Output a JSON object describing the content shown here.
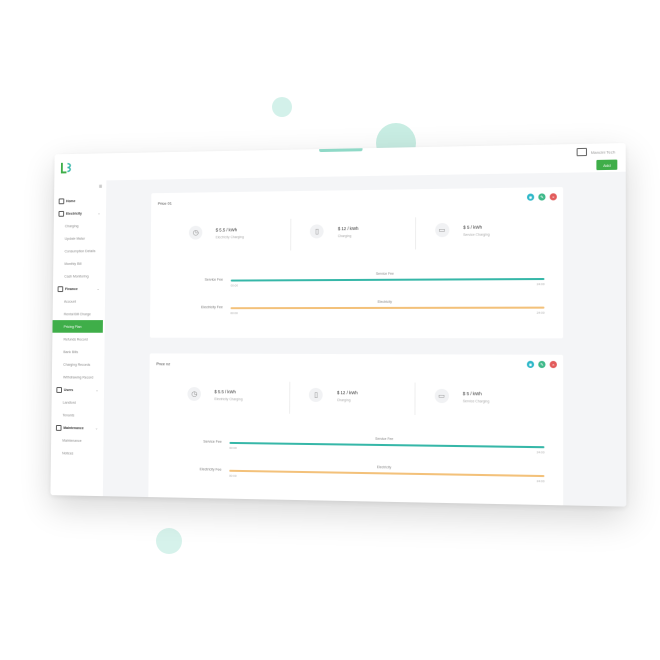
{
  "app": {
    "user_label": "Mancini Tech",
    "add_label": "Add",
    "colors": {
      "accent": "#3fae49",
      "teal": "#36b7a8",
      "orange": "#f3c17a"
    }
  },
  "sidebar": {
    "items": [
      {
        "label": "Home",
        "type": "section",
        "icon": "home-icon"
      },
      {
        "label": "Electricity",
        "type": "section",
        "icon": "electricity-icon",
        "expandable": true
      },
      {
        "label": "Charging",
        "type": "item"
      },
      {
        "label": "Update Meter",
        "type": "item"
      },
      {
        "label": "Consumption Details",
        "type": "item"
      },
      {
        "label": "Monthly Bill",
        "type": "item"
      },
      {
        "label": "Cash Monitoring",
        "type": "item"
      },
      {
        "label": "Finance",
        "type": "section",
        "icon": "finance-icon",
        "expandable": true
      },
      {
        "label": "Account",
        "type": "item"
      },
      {
        "label": "Rental Bill Charge",
        "type": "item"
      },
      {
        "label": "Pricing Plan",
        "type": "item",
        "active": true
      },
      {
        "label": "Refunds Record",
        "type": "item"
      },
      {
        "label": "Bank Bills",
        "type": "item"
      },
      {
        "label": "Charging Records",
        "type": "item"
      },
      {
        "label": "Withdrawing Record",
        "type": "item"
      },
      {
        "label": "Users",
        "type": "section",
        "icon": "users-icon",
        "expandable": true
      },
      {
        "label": "Landlord",
        "type": "item"
      },
      {
        "label": "Tenants",
        "type": "item"
      },
      {
        "label": "Maintenance",
        "type": "section",
        "icon": "maintenance-icon",
        "expandable": true
      },
      {
        "label": "Maintenance",
        "type": "item"
      },
      {
        "label": "Notices",
        "type": "item"
      }
    ]
  },
  "panels": [
    {
      "title": "Price 01",
      "stats": [
        {
          "icon": "clock-icon",
          "value": "$ 5.5 / kWh",
          "label": "Electricity Charging"
        },
        {
          "icon": "battery-icon",
          "value": "$ 12 / kWh",
          "label": "Charging"
        },
        {
          "icon": "phone-icon",
          "value": "$ 5 / kWh",
          "label": "Service Charging"
        }
      ],
      "tracks": [
        {
          "label": "Service Fee",
          "mid": "Service Fee",
          "start": "00:00",
          "end": "24:00"
        },
        {
          "label": "Electricity Fee",
          "mid": "Electricity",
          "start": "00:00",
          "end": "24:00"
        }
      ]
    },
    {
      "title": "Price 02",
      "stats": [
        {
          "icon": "clock-icon",
          "value": "$ 5.5 / kWh",
          "label": "Electricity Charging"
        },
        {
          "icon": "battery-icon",
          "value": "$ 12 / kWh",
          "label": "Charging"
        },
        {
          "icon": "phone-icon",
          "value": "$ 5 / kWh",
          "label": "Service Charging"
        }
      ],
      "tracks": [
        {
          "label": "Service Fee",
          "mid": "Service Fee",
          "start": "00:00",
          "end": "24:00"
        },
        {
          "label": "Electricity Fee",
          "mid": "Electricity",
          "start": "00:00",
          "end": "24:00"
        }
      ]
    }
  ]
}
